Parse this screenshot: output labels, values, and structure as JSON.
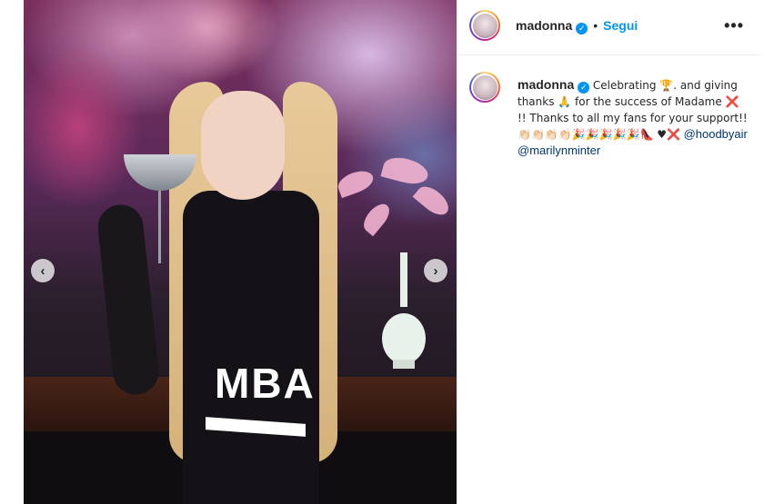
{
  "post": {
    "username": "madonna",
    "follow_label": "Segui",
    "more_label": "•••",
    "caption_text": "Celebrating 🏆. and giving thanks 🙏 for the success of Madame ❌ !! Thanks to all my fans for your support!! 👏🏻👏🏻👏🏻👏🏻🎉🎉🎉🎉🎉👠 ♥❌",
    "mentions": [
      "@hoodbyair",
      "@marilynminter"
    ]
  },
  "photo": {
    "overlay_text": "MBA",
    "prev_label": "‹",
    "next_label": "›"
  },
  "colors": {
    "accent": "#0095f6",
    "text": "#262626",
    "mention": "#00376b"
  },
  "icons": {
    "verified": "verified-badge-icon",
    "more": "more-options-icon",
    "prev": "chevron-left-icon",
    "next": "chevron-right-icon"
  }
}
